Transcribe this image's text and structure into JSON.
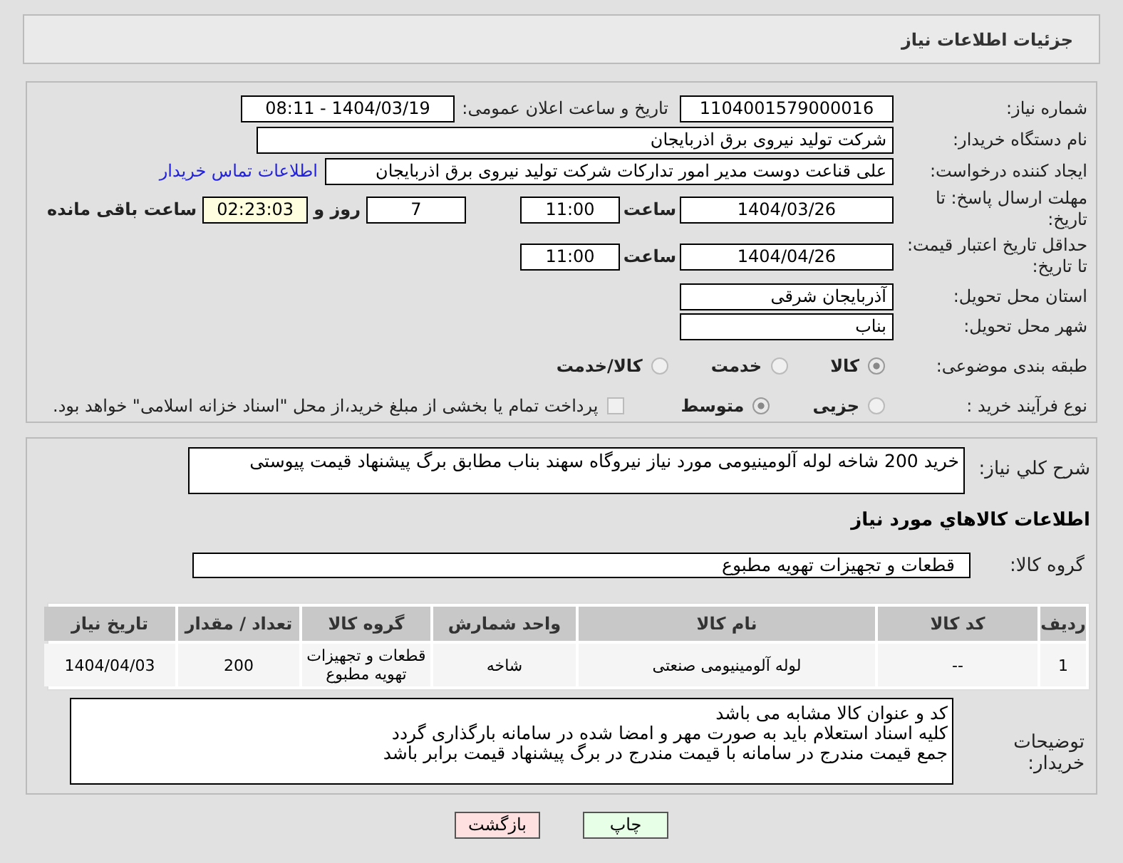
{
  "header": {
    "title": "جزئیات اطلاعات نیاز"
  },
  "need_number": {
    "label": "شماره نیاز:",
    "value": "1104001579000016"
  },
  "announce": {
    "label": "تاریخ و ساعت اعلان عمومی:",
    "value": "1404/03/19 - 08:11"
  },
  "buyer_org": {
    "label": "نام دستگاه خریدار:",
    "value": "شرکت تولید نیروی برق اذربایجان"
  },
  "requester": {
    "label": "ایجاد کننده درخواست:",
    "value": "علی قناعت دوست مدیر امور تدارکات شرکت تولید نیروی برق اذربایجان",
    "link": "اطلاعات تماس خریدار"
  },
  "reply_deadline": {
    "label": "مهلت ارسال پاسخ: تا تاریخ:",
    "date": "1404/03/26",
    "time_label": "ساعت",
    "time": "11:00",
    "days": "7",
    "days_label": "روز و",
    "remaining": "02:23:03",
    "remaining_label": "ساعت باقی مانده"
  },
  "price_validity": {
    "label": "حداقل تاریخ اعتبار قیمت: تا تاریخ:",
    "date": "1404/04/26",
    "time_label": "ساعت",
    "time": "11:00"
  },
  "province": {
    "label": "استان محل تحویل:",
    "value": "آذربایجان شرقی"
  },
  "city": {
    "label": "شهر محل تحویل:",
    "value": "بناب"
  },
  "category": {
    "label": "طبقه بندی موضوعی:",
    "options": [
      {
        "label": "کالا",
        "selected": true
      },
      {
        "label": "خدمت",
        "selected": false
      },
      {
        "label": "کالا/خدمت",
        "selected": false
      }
    ]
  },
  "process": {
    "label": "نوع فرآیند خرید :",
    "options": [
      {
        "label": "جزیی",
        "selected": false
      },
      {
        "label": "متوسط",
        "selected": true
      }
    ],
    "payment_note": {
      "checked": false,
      "text": "پرداخت تمام یا بخشی از مبلغ خرید،از محل \"اسناد خزانه اسلامی\" خواهد بود."
    }
  },
  "description": {
    "label": "شرح کلي نياز:",
    "value": "خرید 200 شاخه لوله آلومینیومی مورد نیاز نیروگاه سهند بناب مطابق برگ پیشنهاد قیمت پیوستی"
  },
  "goods_section": {
    "title": "اطلاعات کالاهاي مورد نياز"
  },
  "goods_group": {
    "label": "گروه کالا:",
    "value": "قطعات و تجهیزات تهویه مطبوع"
  },
  "table": {
    "columns": [
      "ردیف",
      "کد کالا",
      "نام کالا",
      "واحد شمارش",
      "گروه کالا",
      "تعداد / مقدار",
      "تاریخ نیاز"
    ],
    "rows": [
      [
        "1",
        "--",
        "لوله آلومینیومی صنعتی",
        "شاخه",
        "قطعات و تجهیزات تهویه مطبوع",
        "200",
        "1404/04/03"
      ]
    ]
  },
  "buyer_notes": {
    "label": "توضیحات خریدار:",
    "lines": [
      "کد و عنوان کالا مشابه می باشد",
      "کلیه اسناد استعلام باید به صورت مهر و امضا شده در سامانه بارگذاری گردد",
      "جمع قیمت مندرج در سامانه با قیمت مندرج در برگ پیشنهاد قیمت برابر باشد"
    ]
  },
  "buttons": [
    {
      "label": "چاپ",
      "kind": "print"
    },
    {
      "label": "بازگشت",
      "kind": "back"
    }
  ]
}
